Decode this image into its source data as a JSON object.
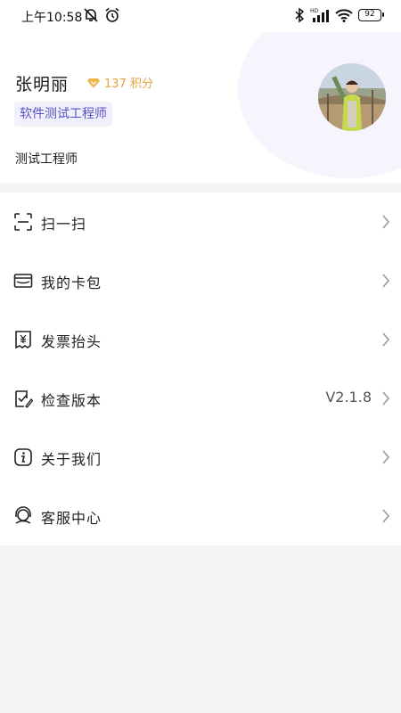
{
  "status_bar": {
    "time": "上午10:58",
    "battery": "92",
    "network_tag": "HD"
  },
  "profile": {
    "name": "张明丽",
    "points": "137 积分",
    "job_title": "软件测试工程师",
    "subtitle": "测试工程师",
    "accent_color": "#5b4ec8",
    "points_color": "#e5a33a"
  },
  "menu": {
    "items": [
      {
        "label": "扫一扫",
        "icon": "scan-icon",
        "value": ""
      },
      {
        "label": "我的卡包",
        "icon": "wallet-icon",
        "value": ""
      },
      {
        "label": "发票抬头",
        "icon": "invoice-icon",
        "value": ""
      },
      {
        "label": "检查版本",
        "icon": "version-check-icon",
        "value": "V2.1.8"
      },
      {
        "label": "关于我们",
        "icon": "info-icon",
        "value": ""
      },
      {
        "label": "客服中心",
        "icon": "customer-service-icon",
        "value": ""
      }
    ]
  }
}
